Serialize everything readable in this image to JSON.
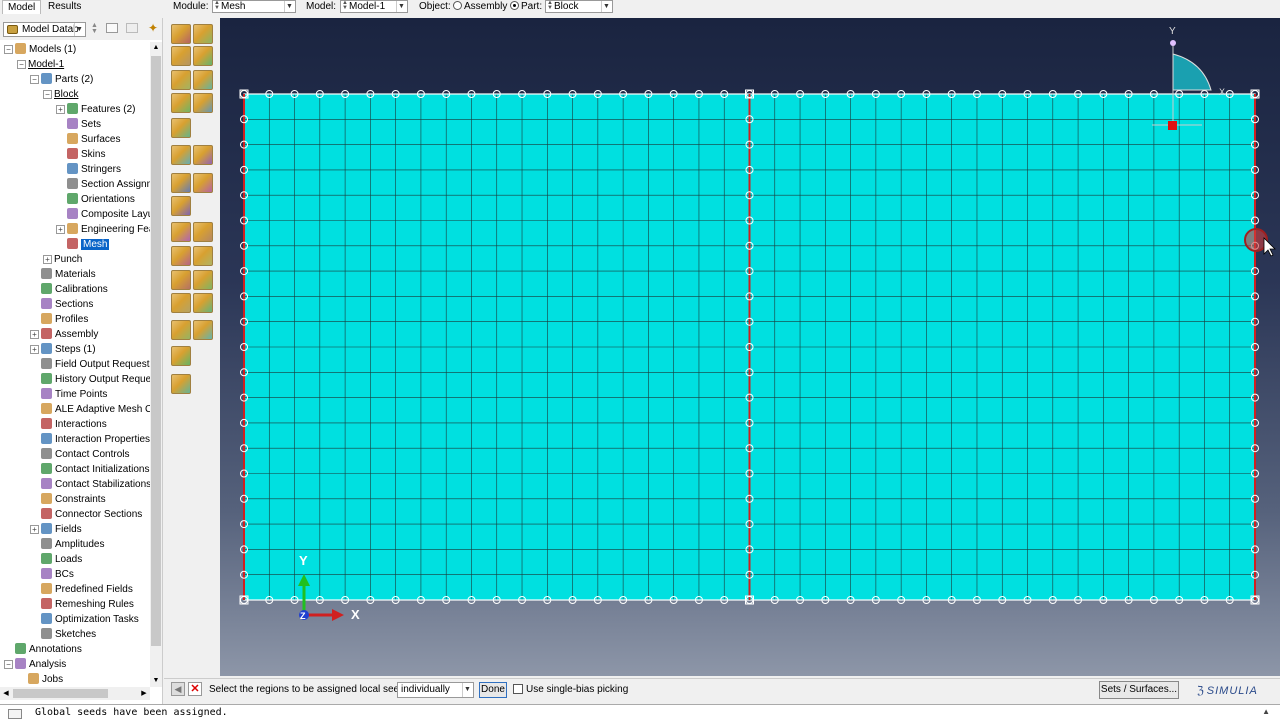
{
  "tabs": {
    "model": "Model",
    "results": "Results"
  },
  "context": {
    "module_label": "Module:",
    "module_value": "Mesh",
    "model_label": "Model:",
    "model_value": "Model-1",
    "object_label": "Object:",
    "assembly_label": "Assembly",
    "part_label": "Part:",
    "part_value": "Block"
  },
  "tree_header": {
    "db_value": "Model Datab"
  },
  "tree": [
    {
      "label": "Models (1)",
      "indent": 0,
      "exp": "-",
      "icon": "models-icon"
    },
    {
      "label": "Model-1",
      "indent": 1,
      "exp": "-",
      "icon": "",
      "underline": true
    },
    {
      "label": "Parts (2)",
      "indent": 2,
      "exp": "-",
      "icon": "parts-icon"
    },
    {
      "label": "Block",
      "indent": 3,
      "exp": "-",
      "icon": "",
      "underline": true
    },
    {
      "label": "Features (2)",
      "indent": 4,
      "exp": "+",
      "icon": "features-icon"
    },
    {
      "label": "Sets",
      "indent": 4,
      "exp": "",
      "icon": "sets-icon"
    },
    {
      "label": "Surfaces",
      "indent": 4,
      "exp": "",
      "icon": "surfaces-icon"
    },
    {
      "label": "Skins",
      "indent": 4,
      "exp": "",
      "icon": "skins-icon"
    },
    {
      "label": "Stringers",
      "indent": 4,
      "exp": "",
      "icon": "stringers-icon"
    },
    {
      "label": "Section Assignme",
      "indent": 4,
      "exp": "",
      "icon": "section-assignment-icon"
    },
    {
      "label": "Orientations",
      "indent": 4,
      "exp": "",
      "icon": "orientations-icon"
    },
    {
      "label": "Composite Layups",
      "indent": 4,
      "exp": "",
      "icon": "composite-layups-icon"
    },
    {
      "label": "Engineering Featu",
      "indent": 4,
      "exp": "+",
      "icon": "engineering-features-icon"
    },
    {
      "label": "Mesh",
      "indent": 4,
      "exp": "",
      "icon": "mesh-icon",
      "selected": true
    },
    {
      "label": "Punch",
      "indent": 3,
      "exp": "+",
      "icon": ""
    },
    {
      "label": "Materials",
      "indent": 2,
      "exp": "",
      "icon": "materials-icon"
    },
    {
      "label": "Calibrations",
      "indent": 2,
      "exp": "",
      "icon": "calibrations-icon"
    },
    {
      "label": "Sections",
      "indent": 2,
      "exp": "",
      "icon": "sections-icon"
    },
    {
      "label": "Profiles",
      "indent": 2,
      "exp": "",
      "icon": "profiles-icon"
    },
    {
      "label": "Assembly",
      "indent": 2,
      "exp": "+",
      "icon": "assembly-icon"
    },
    {
      "label": "Steps (1)",
      "indent": 2,
      "exp": "+",
      "icon": "steps-icon"
    },
    {
      "label": "Field Output Requests",
      "indent": 2,
      "exp": "",
      "icon": "field-output-icon"
    },
    {
      "label": "History Output Requests",
      "indent": 2,
      "exp": "",
      "icon": "history-output-icon"
    },
    {
      "label": "Time Points",
      "indent": 2,
      "exp": "",
      "icon": "time-points-icon"
    },
    {
      "label": "ALE Adaptive Mesh Con",
      "indent": 2,
      "exp": "",
      "icon": "ale-mesh-icon"
    },
    {
      "label": "Interactions",
      "indent": 2,
      "exp": "",
      "icon": "interactions-icon"
    },
    {
      "label": "Interaction Properties",
      "indent": 2,
      "exp": "",
      "icon": "interaction-properties-icon"
    },
    {
      "label": "Contact Controls",
      "indent": 2,
      "exp": "",
      "icon": "contact-controls-icon"
    },
    {
      "label": "Contact Initializations",
      "indent": 2,
      "exp": "",
      "icon": "contact-init-icon"
    },
    {
      "label": "Contact Stabilizations",
      "indent": 2,
      "exp": "",
      "icon": "contact-stab-icon"
    },
    {
      "label": "Constraints",
      "indent": 2,
      "exp": "",
      "icon": "constraints-icon"
    },
    {
      "label": "Connector Sections",
      "indent": 2,
      "exp": "",
      "icon": "connector-sections-icon"
    },
    {
      "label": "Fields",
      "indent": 2,
      "exp": "+",
      "icon": "fields-icon"
    },
    {
      "label": "Amplitudes",
      "indent": 2,
      "exp": "",
      "icon": "amplitudes-icon"
    },
    {
      "label": "Loads",
      "indent": 2,
      "exp": "",
      "icon": "loads-icon"
    },
    {
      "label": "BCs",
      "indent": 2,
      "exp": "",
      "icon": "bcs-icon"
    },
    {
      "label": "Predefined Fields",
      "indent": 2,
      "exp": "",
      "icon": "predefined-fields-icon"
    },
    {
      "label": "Remeshing Rules",
      "indent": 2,
      "exp": "",
      "icon": "remeshing-rules-icon"
    },
    {
      "label": "Optimization Tasks",
      "indent": 2,
      "exp": "",
      "icon": "optimization-icon"
    },
    {
      "label": "Sketches",
      "indent": 2,
      "exp": "",
      "icon": "sketches-icon"
    },
    {
      "label": "Annotations",
      "indent": 0,
      "exp": "",
      "icon": "annotations-icon"
    },
    {
      "label": "Analysis",
      "indent": 0,
      "exp": "-",
      "icon": "analysis-icon"
    },
    {
      "label": "Jobs",
      "indent": 1,
      "exp": "",
      "icon": "jobs-icon"
    }
  ],
  "viewport": {
    "background_top": "#1a2440",
    "mesh_fill": "#00e0e0",
    "mesh_line": "#1a3a3a",
    "mesh_cols": 40,
    "mesh_rows": 20,
    "triad": {
      "y": "Y",
      "z": "Z",
      "x": "X"
    },
    "view_triad": {
      "y": "Y",
      "x": "X"
    }
  },
  "prompt": {
    "text": "Select the regions to be assigned local seeds",
    "method_value": "individually",
    "done_label": "Done",
    "single_bias_label": "Use single-bias picking",
    "sets_label": "Sets / Surfaces...",
    "brand": "SIMULIA"
  },
  "message": "Global seeds have been assigned."
}
